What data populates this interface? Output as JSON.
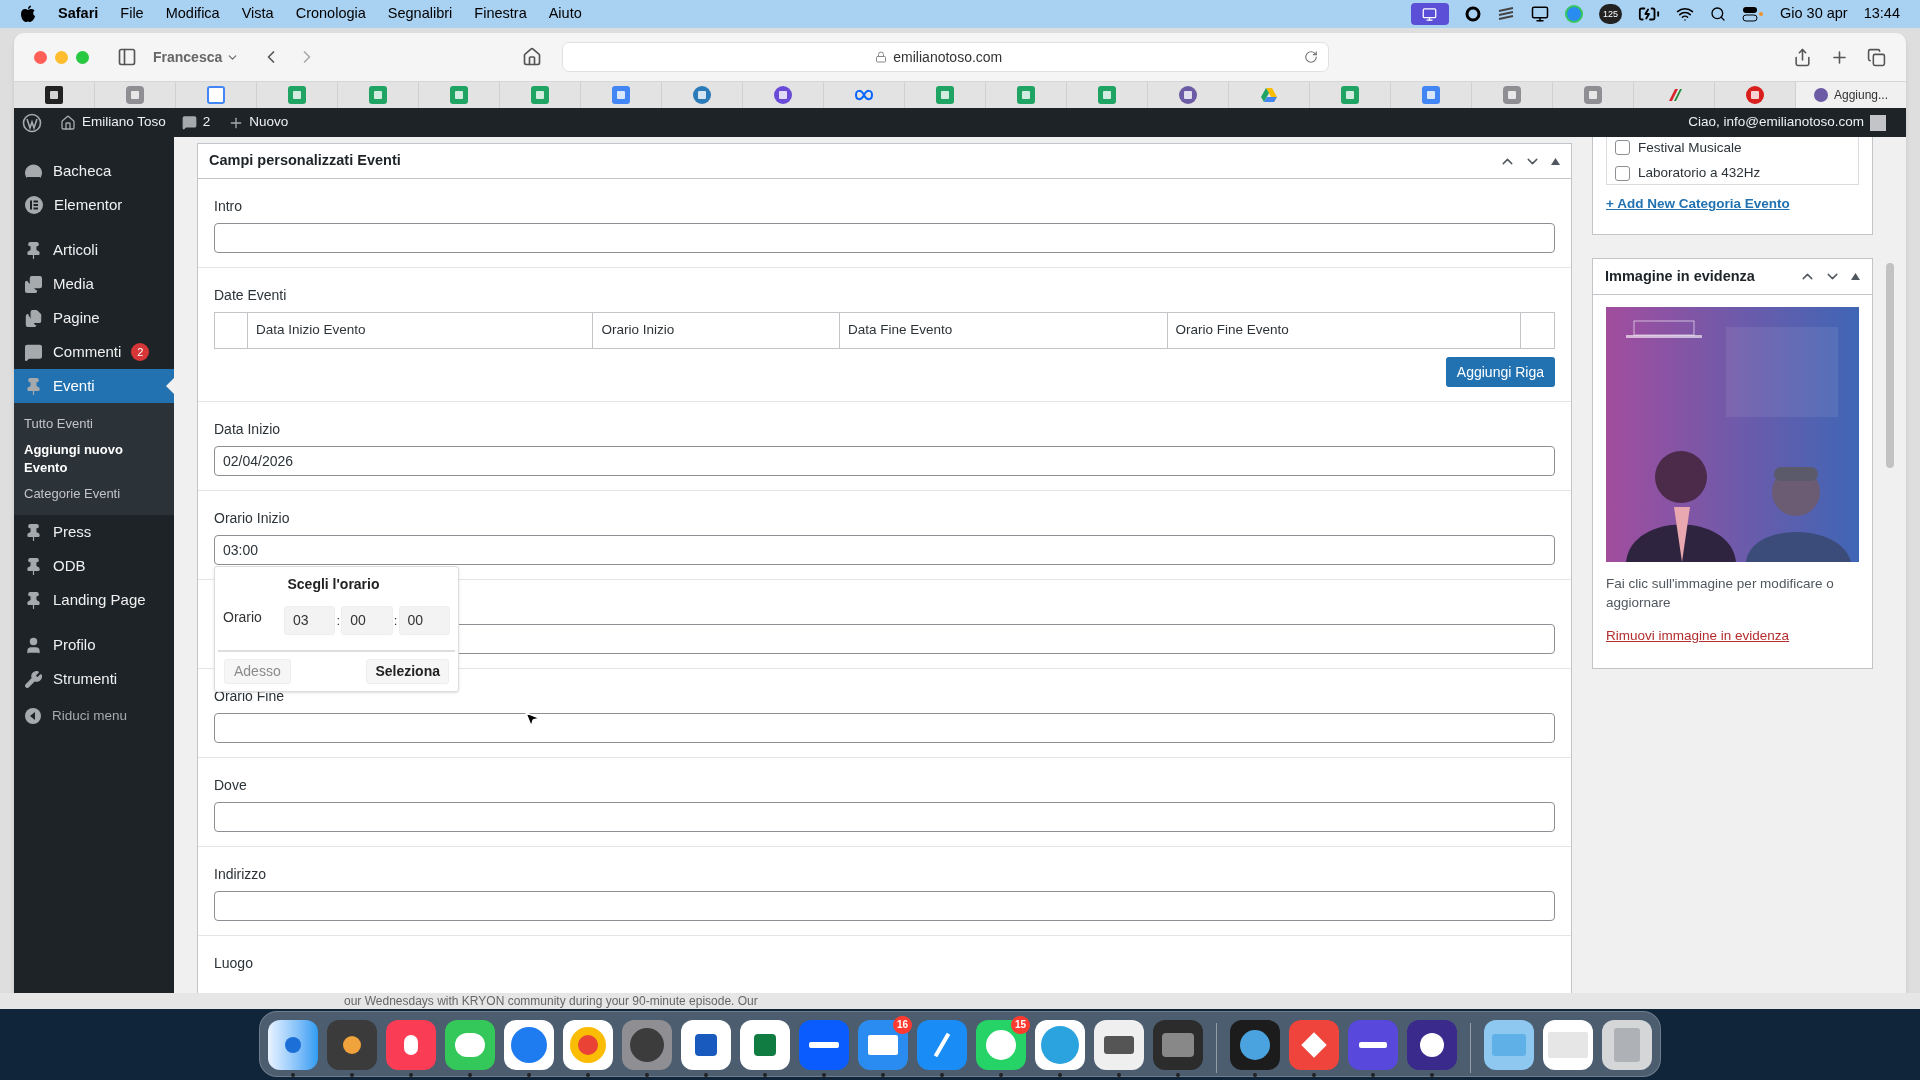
{
  "menu_bar": {
    "app": "Safari",
    "items": [
      "File",
      "Modifica",
      "Vista",
      "Cronologia",
      "Segnalibri",
      "Finestra",
      "Aiuto"
    ],
    "badge": "125",
    "date": "Gio 30 apr",
    "time": "13:44"
  },
  "browser": {
    "profile": "Francesca",
    "url": "emilianotoso.com",
    "bookmarks": [
      {
        "kind": "dark"
      },
      {
        "kind": "grey"
      },
      {
        "kind": "calendar"
      },
      {
        "kind": "sheet"
      },
      {
        "kind": "sheet"
      },
      {
        "kind": "sheet"
      },
      {
        "kind": "sheet"
      },
      {
        "kind": "doc"
      },
      {
        "kind": "bluecircle"
      },
      {
        "kind": "canva"
      },
      {
        "kind": "meta"
      },
      {
        "kind": "sheet"
      },
      {
        "kind": "sheet"
      },
      {
        "kind": "sheet"
      },
      {
        "kind": "purple"
      },
      {
        "kind": "drive"
      },
      {
        "kind": "sheet"
      },
      {
        "kind": "doc"
      },
      {
        "kind": "grey"
      },
      {
        "kind": "grey"
      },
      {
        "kind": "train"
      },
      {
        "kind": "red"
      }
    ],
    "more": "Aggiung..."
  },
  "admin_bar": {
    "site": "Emiliano Toso",
    "comments": "2",
    "new": "Nuovo",
    "greeting": "Ciao, info@emilianotoso.com"
  },
  "sidebar": {
    "groups": [
      [
        {
          "kind": "dashboard",
          "label": "Bacheca",
          "selected": false
        },
        {
          "kind": "elementor",
          "label": "Elementor",
          "selected": false
        }
      ],
      [
        {
          "kind": "post",
          "label": "Articoli",
          "selected": false
        },
        {
          "kind": "media",
          "label": "Media",
          "selected": false
        },
        {
          "kind": "page",
          "label": "Pagine",
          "selected": false
        },
        {
          "kind": "comments",
          "label": "Commenti",
          "badge": "2",
          "selected": false
        },
        {
          "kind": "post",
          "label": "Eventi",
          "selected": true,
          "children": [
            {
              "label": "Tutto Eventi",
              "selected": false
            },
            {
              "label": "Aggiungi nuovo Evento",
              "selected": true
            },
            {
              "label": "Categorie Eventi",
              "selected": false
            }
          ]
        },
        {
          "kind": "post",
          "label": "Press",
          "selected": false
        },
        {
          "kind": "post",
          "label": "ODB",
          "selected": false
        },
        {
          "kind": "post",
          "label": "Landing Page",
          "selected": false
        }
      ],
      [
        {
          "kind": "user",
          "label": "Profilo",
          "selected": false
        },
        {
          "kind": "tools",
          "label": "Strumenti",
          "selected": false
        }
      ]
    ],
    "collapse": "Riduci menu"
  },
  "metabox": {
    "title": "Campi personalizzati Eventi",
    "fields": [
      {
        "kind": "text",
        "label": "Intro"
      },
      {
        "kind": "repeater",
        "label": "Date Eventi",
        "columns": [
          "Data Inizio Evento",
          "Orario Inizio",
          "Data Fine Evento",
          "Orario Fine Evento"
        ],
        "button": "Aggiungi Riga"
      },
      {
        "kind": "text",
        "label": "Data Inizio",
        "value": "02/04/2026"
      },
      {
        "kind": "text",
        "label": "Orario Inizio",
        "value": "03:00",
        "picker_open": true
      },
      {
        "kind": "text"
      },
      {
        "kind": "text",
        "label": "Orario Fine"
      },
      {
        "kind": "text",
        "label": "Dove"
      },
      {
        "kind": "text",
        "label": "Indirizzo"
      },
      {
        "kind": "cutoff",
        "label": "Luogo"
      }
    ],
    "time_picker": {
      "title": "Scegli l'orario",
      "label": "Orario",
      "hours": "03",
      "minutes": "00",
      "seconds": "00",
      "separators": [
        ":",
        ":"
      ],
      "now": "Adesso",
      "now_disabled": true,
      "select": "Seleziona"
    }
  },
  "categories": {
    "items": [
      {
        "label": "Festival Musicale",
        "checked": false
      },
      {
        "label": "Laboratorio a 432Hz",
        "checked": false
      }
    ],
    "add_link": "+ Add New Categoria Evento"
  },
  "featured_image": {
    "title": "Immagine in evidenza",
    "hint": "Fai clic sull'immagine per modificare o aggiornare",
    "remove_link": "Rimuovi immagine in evidenza"
  },
  "background_window": {
    "text": "our Wednesdays with KRYON community during your 90-minute episode. Our"
  },
  "dock": {
    "items": [
      {
        "kind": "finder",
        "running": true
      },
      {
        "kind": "keychain",
        "running": true
      },
      {
        "kind": "music",
        "running": true
      },
      {
        "kind": "messages",
        "running": true
      },
      {
        "kind": "safari",
        "running": true
      },
      {
        "kind": "chrome",
        "running": true
      },
      {
        "kind": "settings",
        "running": true
      },
      {
        "kind": "word",
        "running": true
      },
      {
        "kind": "excel",
        "running": true
      },
      {
        "kind": "zoom",
        "running": true
      },
      {
        "kind": "mail",
        "running": true,
        "badge": "16"
      },
      {
        "kind": "appstore",
        "running": true
      },
      {
        "kind": "whatsapp",
        "running": true,
        "badge": "15"
      },
      {
        "kind": "telegram",
        "running": true
      },
      {
        "kind": "printer",
        "running": true
      },
      {
        "kind": "photobooth",
        "running": true
      },
      {
        "kind": "divider"
      },
      {
        "kind": "quicktime",
        "running": true
      },
      {
        "kind": "anydesk",
        "running": true
      },
      {
        "kind": "stripes",
        "running": true
      },
      {
        "kind": "grammar",
        "running": true
      },
      {
        "kind": "divider"
      },
      {
        "kind": "folder",
        "running": false
      },
      {
        "kind": "window",
        "running": false
      },
      {
        "kind": "trash",
        "running": false
      }
    ]
  }
}
